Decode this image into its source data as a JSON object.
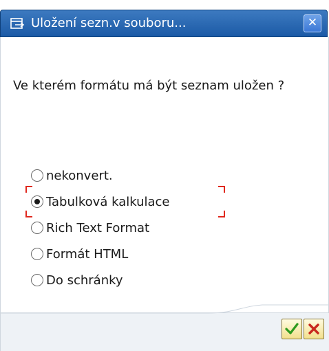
{
  "dialog": {
    "title": "Uložení sezn.v souboru...",
    "close_symbol": "✕",
    "question": "Ve kterém formátu má být seznam uložen ?",
    "options": [
      {
        "label": "nekonvert.",
        "selected": false
      },
      {
        "label": "Tabulková kalkulace",
        "selected": true
      },
      {
        "label": "Rich Text Format",
        "selected": false
      },
      {
        "label": "Formát HTML",
        "selected": false
      },
      {
        "label": "Do schránky",
        "selected": false
      }
    ],
    "buttons": {
      "ok_icon": "checkmark-icon",
      "cancel_icon": "cross-icon"
    },
    "colors": {
      "titlebar": "#1b5aa6",
      "focus_frame": "#e0281e",
      "ok_check": "#2e9a1e",
      "cancel_cross": "#c8281e"
    }
  }
}
